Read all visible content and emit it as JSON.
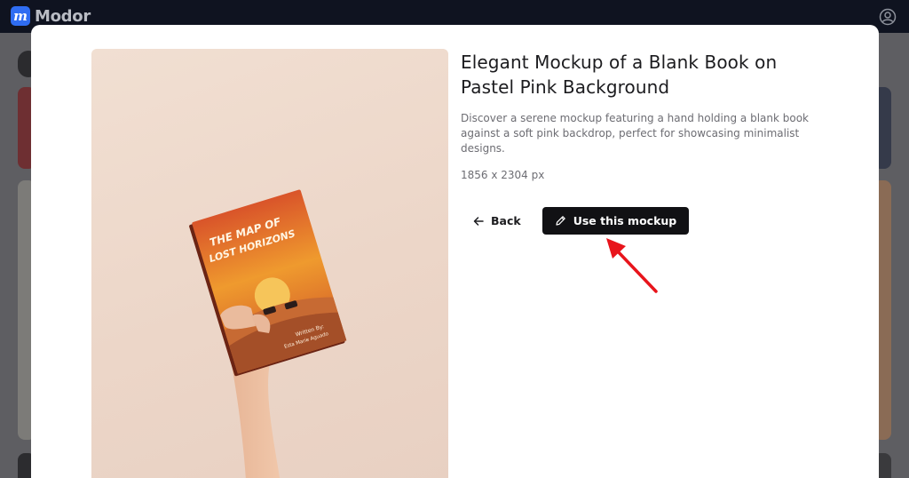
{
  "app": {
    "name": "Modor",
    "logo_letter": "m"
  },
  "header": {
    "user_icon": "user-circle-icon"
  },
  "modal": {
    "title": "Elegant Mockup of a Blank Book on Pastel Pink Background",
    "description": "Discover a serene mockup featuring a hand holding a blank book against a soft pink backdrop, perfect for showcasing minimalist designs.",
    "dimensions": "1856 x 2304 px",
    "back_label": "Back",
    "use_label": "Use this mockup",
    "book": {
      "title_line1": "THE MAP OF",
      "title_line2": "LOST HORIZONS",
      "author_line1": "Written By:",
      "author_line2": "Esta Marie Aguado"
    }
  },
  "annotation": {
    "arrow_color": "#e8141b"
  }
}
